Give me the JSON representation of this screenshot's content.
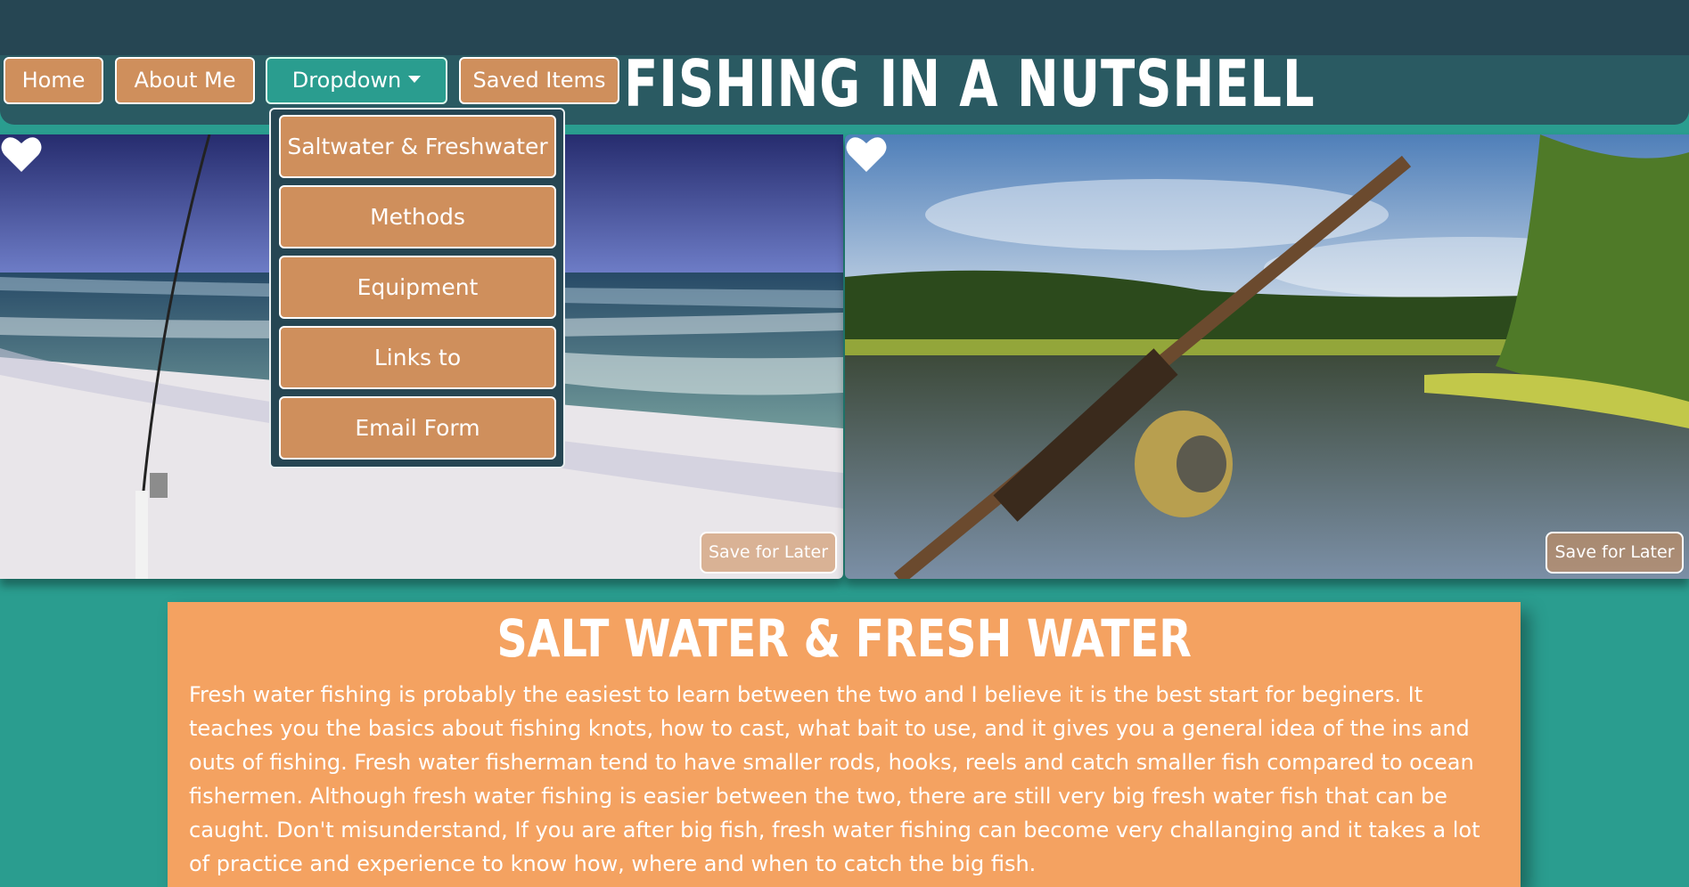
{
  "nav": {
    "home": "Home",
    "about": "About Me",
    "dropdown": "Dropdown",
    "saved": "Saved Items"
  },
  "site_title": "FISHING IN A NUTSHELL",
  "dropdown_menu": [
    {
      "label": "Saltwater & Freshwater"
    },
    {
      "label": "Methods"
    },
    {
      "label": "Equipment"
    },
    {
      "label": "Links to"
    },
    {
      "label": "Email Form"
    }
  ],
  "cards": [
    {
      "save_label": "Save for Later",
      "icon": "heart-icon"
    },
    {
      "save_label": "Save for Later",
      "icon": "heart-icon"
    }
  ],
  "section": {
    "heading": "SALT WATER & FRESH WATER",
    "body": "Fresh water fishing is probably the easiest to learn between the two and I believe it is the best start for beginers. It teaches you the basics about fishing knots, how to cast, what bait to use, and it gives you a general idea of the ins and outs of fishing. Fresh water fisherman tend to have smaller rods, hooks, reels and catch smaller fish compared to ocean fishermen. Although fresh water fishing is easier between the two, there are still very big fresh water fish that can be caught. Don't misunderstand, If you are after big fish, fresh water fishing can become very challanging and it takes a lot of practice and experience to know how, where and when to catch the big fish."
  },
  "colors": {
    "background": "#2a9d8f",
    "header": "#264653",
    "button": "#cf8f5c",
    "content": "#f4a261"
  }
}
